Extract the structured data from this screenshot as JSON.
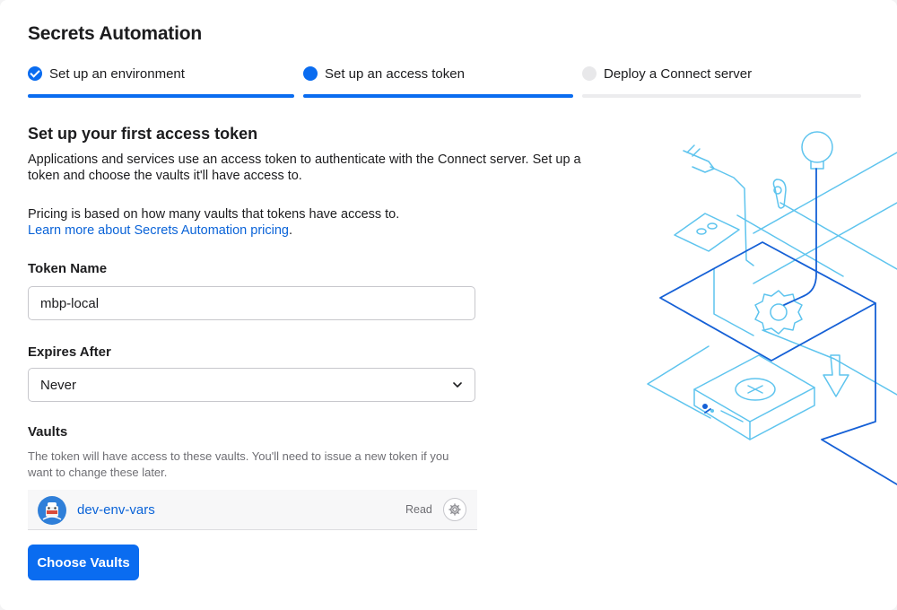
{
  "page": {
    "title": "Secrets Automation"
  },
  "steps": [
    {
      "label": "Set up an environment",
      "state": "done"
    },
    {
      "label": "Set up an access token",
      "state": "active"
    },
    {
      "label": "Deploy a Connect server",
      "state": "todo"
    }
  ],
  "section": {
    "heading": "Set up your first access token",
    "intro_line1": "Applications and services use an access token to authenticate with the Connect server. Set up a",
    "intro_line2": "token and choose the vaults it'll have access to.",
    "pricing_text": "Pricing is based on how many vaults that tokens have access to.",
    "pricing_link": "Learn more about Secrets Automation pricing",
    "pricing_link_suffix": "."
  },
  "token_name": {
    "label": "Token Name",
    "value": "mbp-local"
  },
  "expires": {
    "label": "Expires After",
    "selected": "Never"
  },
  "vaults": {
    "label": "Vaults",
    "hint": "The token will have access to these vaults. You'll need to issue a new token if you want to change these later.",
    "items": [
      {
        "name": "dev-env-vars",
        "permission": "Read",
        "icon": "vault-avatar-icon"
      }
    ],
    "choose_button": "Choose Vaults"
  },
  "colors": {
    "accent": "#0a6cf0",
    "link": "#0a63d8",
    "illustration_light": "#5ec4ee",
    "illustration_dark": "#1560d6"
  }
}
